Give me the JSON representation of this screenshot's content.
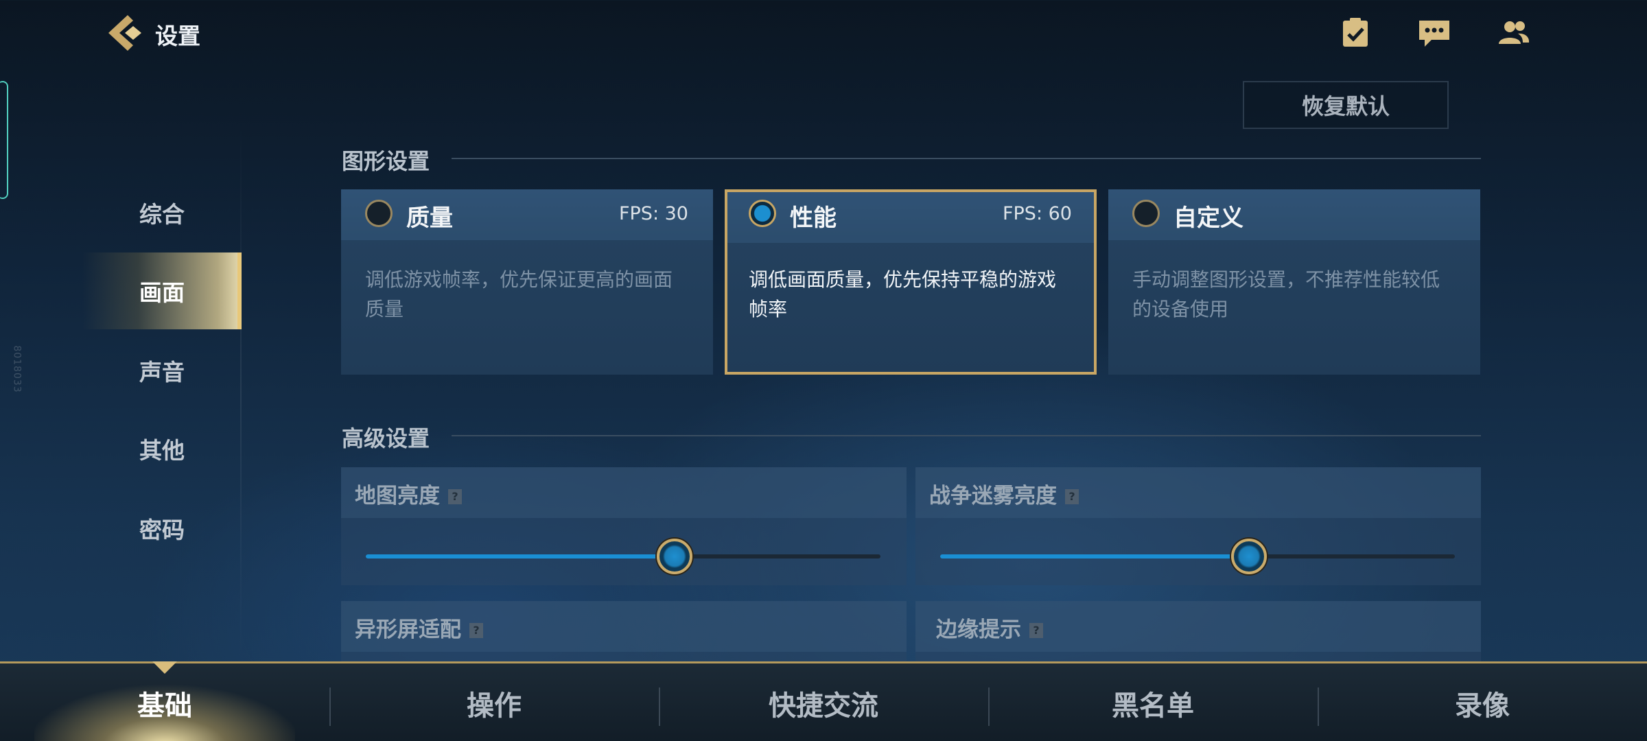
{
  "header": {
    "title": "设置",
    "icons": [
      "task-check-icon",
      "chat-icon",
      "friends-icon"
    ]
  },
  "side_code": "8018033",
  "restore_default_label": "恢复默认",
  "sidebar": {
    "items": [
      {
        "label": "综合",
        "active": false
      },
      {
        "label": "画面",
        "active": true
      },
      {
        "label": "声音",
        "active": false
      },
      {
        "label": "其他",
        "active": false
      },
      {
        "label": "密码",
        "active": false
      }
    ]
  },
  "graphics": {
    "title": "图形设置",
    "options": [
      {
        "name": "质量",
        "fps": "FPS: 30",
        "desc": "调低游戏帧率，优先保证更高的画面质量",
        "selected": false
      },
      {
        "name": "性能",
        "fps": "FPS: 60",
        "desc": "调低画面质量，优先保持平稳的游戏帧率",
        "selected": true
      },
      {
        "name": "自定义",
        "fps": "",
        "desc": "手动调整图形设置，不推荐性能较低的设备使用",
        "selected": false
      }
    ]
  },
  "advanced": {
    "title": "高级设置",
    "items": [
      {
        "label": "地图亮度",
        "level": 0.6
      },
      {
        "label": "战争迷雾亮度",
        "level": 0.6
      },
      {
        "label": "异形屏适配"
      },
      {
        "label": "边缘提示"
      }
    ]
  },
  "bottom_tabs": {
    "items": [
      {
        "label": "基础",
        "active": true
      },
      {
        "label": "操作",
        "active": false
      },
      {
        "label": "快捷交流",
        "active": false
      },
      {
        "label": "黑名单",
        "active": false
      },
      {
        "label": "录像",
        "active": false
      }
    ]
  },
  "colors": {
    "accent_gold": "#c8a664",
    "slider_blue": "#1a8fd4"
  }
}
